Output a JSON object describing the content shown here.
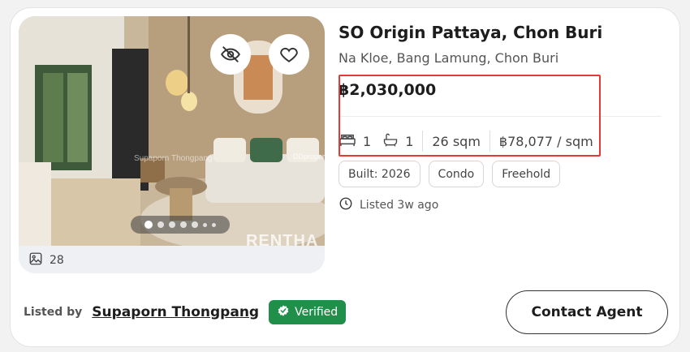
{
  "listing": {
    "title": "SO Origin Pattaya, Chon Buri",
    "location": "Na Kloe, Bang Lamung, Chon Buri",
    "price": "฿2,030,000",
    "beds": "1",
    "baths": "1",
    "area": "26 sqm",
    "price_per_sqm": "฿78,077 / sqm",
    "tags": [
      "Built: 2026",
      "Condo",
      "Freehold"
    ],
    "listed_time": "Listed 3w ago"
  },
  "photo": {
    "count": "28",
    "carousel_dots": 7,
    "active_dot": 1,
    "watermarks": [
      "RENTHA",
      "DDproper",
      "Supaporn Thongpang"
    ]
  },
  "agent": {
    "listed_by_label": "Listed by",
    "name": "Supaporn Thongpang",
    "verified_label": "Verified"
  },
  "actions": {
    "contact_label": "Contact Agent"
  },
  "colors": {
    "verified_bg": "#1f8f4a",
    "highlight_border": "#e53935"
  },
  "icons": [
    "eye-off-icon",
    "heart-icon",
    "bed-icon",
    "bath-icon",
    "clock-icon",
    "gallery-icon",
    "check-badge-icon"
  ]
}
